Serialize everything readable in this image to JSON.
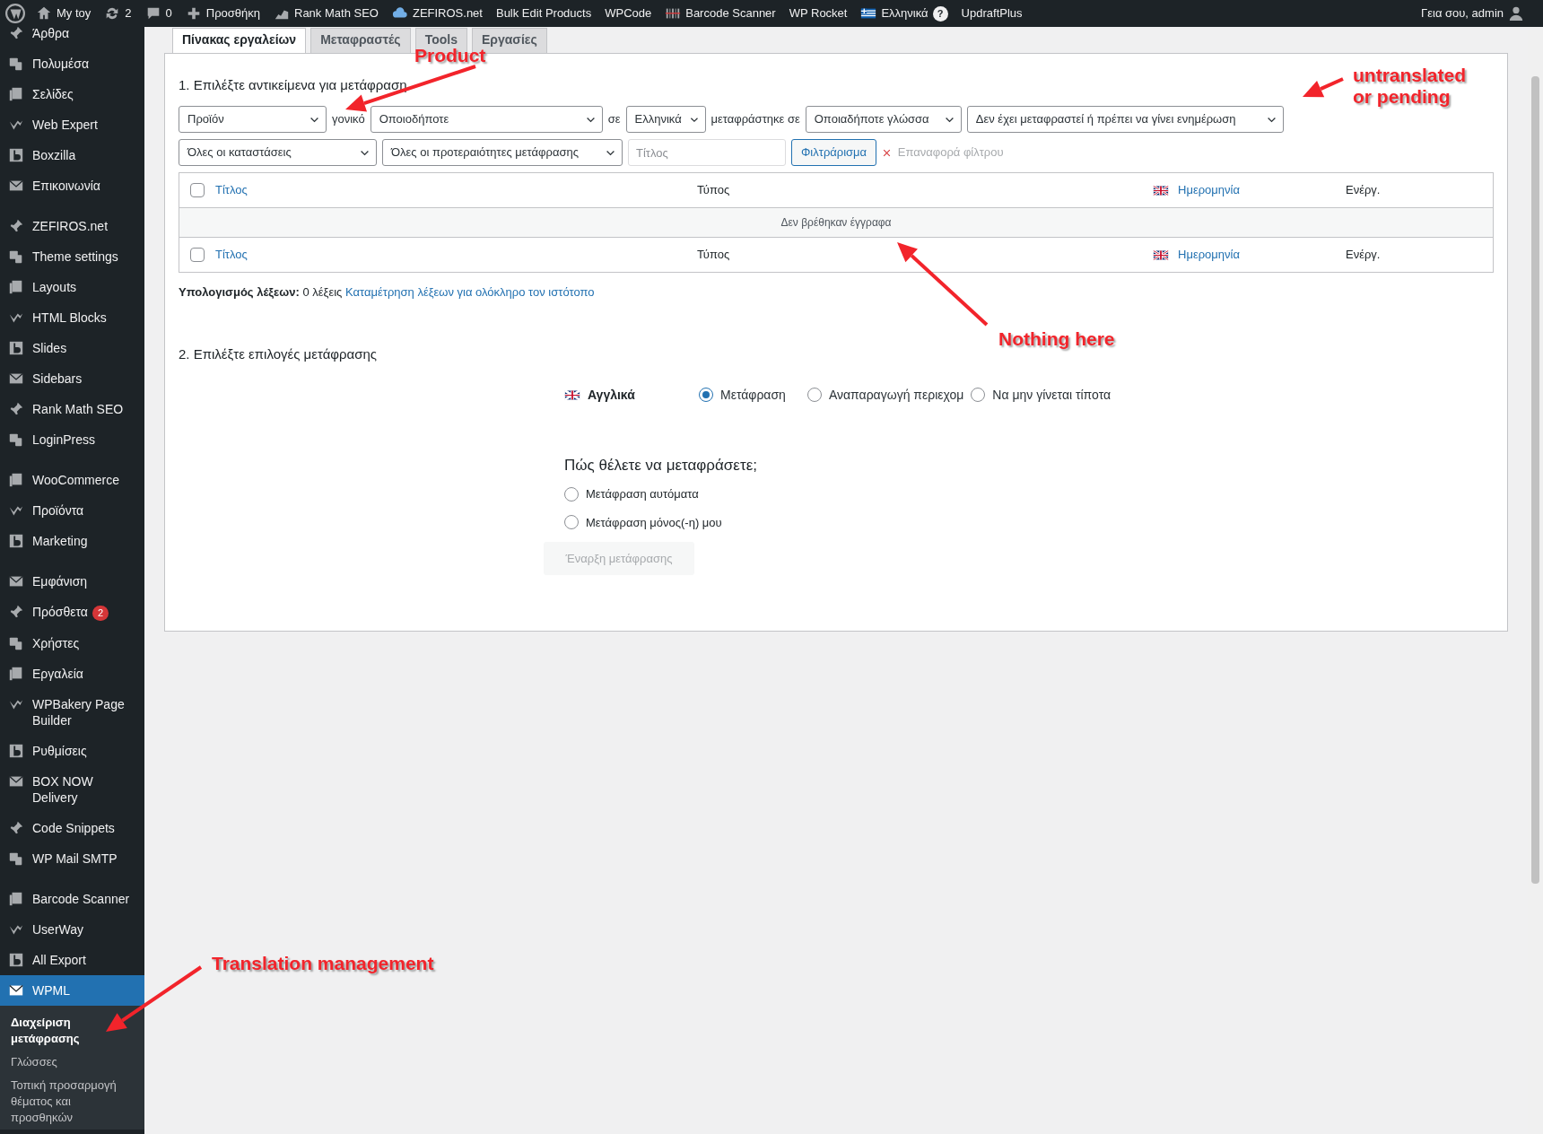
{
  "admin_bar": {
    "items": [
      {
        "label": "My toy"
      },
      {
        "label": "2"
      },
      {
        "label": "0"
      },
      {
        "label": "Προσθήκη"
      },
      {
        "label": "Rank Math SEO"
      },
      {
        "label": "ZEFIROS.net"
      },
      {
        "label": "Bulk Edit Products"
      },
      {
        "label": "WPCode"
      },
      {
        "label": "Barcode Scanner"
      },
      {
        "label": "WP Rocket"
      },
      {
        "label": "Ελληνικά",
        "badge": "?"
      },
      {
        "label": "UpdraftPlus"
      }
    ],
    "greeting": "Γεια σου, admin"
  },
  "sidebar": {
    "groups": [
      [
        {
          "label": "Άρθρα",
          "selected": false
        },
        {
          "label": "Πολυμέσα",
          "selected": false
        },
        {
          "label": "Σελίδες",
          "selected": false
        },
        {
          "label": "Web Expert",
          "selected": false
        },
        {
          "label": "Boxzilla",
          "selected": false
        },
        {
          "label": "Επικοινωνία",
          "selected": false
        }
      ],
      [
        {
          "label": "ZEFIROS.net",
          "selected": false
        },
        {
          "label": "Theme settings",
          "selected": false
        },
        {
          "label": "Layouts",
          "selected": false
        },
        {
          "label": "HTML Blocks",
          "selected": false
        },
        {
          "label": "Slides",
          "selected": false
        },
        {
          "label": "Sidebars",
          "selected": false
        },
        {
          "label": "Rank Math SEO",
          "selected": false
        },
        {
          "label": "LoginPress",
          "selected": false
        }
      ],
      [
        {
          "label": "WooCommerce",
          "selected": false
        },
        {
          "label": "Προϊόντα",
          "selected": false
        },
        {
          "label": "Marketing",
          "selected": false
        }
      ],
      [
        {
          "label": "Εμφάνιση",
          "selected": false
        },
        {
          "label": "Πρόσθετα",
          "selected": false,
          "badge": "2"
        },
        {
          "label": "Χρήστες",
          "selected": false
        },
        {
          "label": "Εργαλεία",
          "selected": false
        },
        {
          "label": "WPBakery Page Builder",
          "selected": false
        },
        {
          "label": "Ρυθμίσεις",
          "selected": false
        },
        {
          "label": "BOX NOW Delivery",
          "selected": false
        },
        {
          "label": "Code Snippets",
          "selected": false
        },
        {
          "label": "WP Mail SMTP",
          "selected": false
        }
      ],
      [
        {
          "label": "Barcode Scanner",
          "selected": false
        },
        {
          "label": "UserWay",
          "selected": false
        },
        {
          "label": "All Export",
          "selected": false
        },
        {
          "label": "WPML",
          "selected": true
        }
      ]
    ],
    "submenu": [
      {
        "label": "Διαχείριση μετάφρασης",
        "selected": true
      },
      {
        "label": "Γλώσσες",
        "selected": false
      },
      {
        "label": "Τοπική προσαρμογή θέματος και προσθηκών",
        "selected": false
      }
    ]
  },
  "tabs": [
    {
      "label": "Πίνακας εργαλείων",
      "selected": true
    },
    {
      "label": "Μεταφραστές",
      "selected": false
    },
    {
      "label": "Tools",
      "selected": false
    },
    {
      "label": "Εργασίες",
      "selected": false
    }
  ],
  "section1": {
    "title": "1. Επιλέξτε αντικείμενα για μετάφραση",
    "filter_rows": [
      [
        {
          "kind": "select",
          "value": "Προϊόν"
        },
        {
          "kind": "label",
          "text": "γονικό"
        },
        {
          "kind": "select",
          "value": "Οποιοδήποτε"
        },
        {
          "kind": "label",
          "text": "σε"
        },
        {
          "kind": "select",
          "value": "Ελληνικά"
        },
        {
          "kind": "label",
          "text": "μεταφράστηκε σε"
        },
        {
          "kind": "select",
          "value": "Οποιαδήποτε γλώσσα"
        },
        {
          "kind": "select",
          "value": "Δεν έχει μεταφραστεί ή πρέπει να γίνει ενημέρωση"
        }
      ],
      [
        {
          "kind": "select",
          "value": "Όλες οι καταστάσεις"
        },
        {
          "kind": "select",
          "value": "Όλες οι προτεραιότητες μετάφρασης"
        },
        {
          "kind": "input",
          "placeholder": "Τίτλος"
        },
        {
          "kind": "button",
          "text": "Φιλτράρισμα"
        },
        {
          "kind": "reset",
          "text": "Επαναφορά φίλτρου"
        }
      ]
    ],
    "table": {
      "header": [
        {
          "label": "Τίτλος",
          "kind": "sortable"
        },
        {
          "label": "Τύπος",
          "kind": "plain"
        },
        {
          "label": "Ημερομηνία",
          "kind": "sortable-flag"
        },
        {
          "label": "Ενέργ.",
          "kind": "plain"
        }
      ],
      "header_checked": false,
      "empty_message": "Δεν βρέθηκαν έγγραφα",
      "footer": [
        {
          "label": "Τίτλος",
          "kind": "sortable"
        },
        {
          "label": "Τύπος",
          "kind": "plain"
        },
        {
          "label": "Ημερομηνία",
          "kind": "sortable-flag"
        },
        {
          "label": "Ενέργ.",
          "kind": "plain"
        }
      ],
      "footer_checked": false
    },
    "word_count": {
      "label": "Υπολογισμός λέξεων:",
      "value": "0 λέξεις",
      "link": "Καταμέτρηση λέξεων για ολόκληρο τον ιστότοπο"
    }
  },
  "section2": {
    "title": "2. Επιλέξτε επιλογές μετάφρασης",
    "language": "Αγγλικά",
    "options": [
      {
        "label": "Μετάφραση",
        "selected": true
      },
      {
        "label": "Αναπαραγωγή περιεχομ",
        "selected": false
      },
      {
        "label": "Να μην γίνεται τίποτα",
        "selected": false
      }
    ],
    "question": "Πώς θέλετε να μεταφράσετε;",
    "methods": [
      {
        "label": "Μετάφραση αυτόματα",
        "selected": false
      },
      {
        "label": "Μετάφραση μόνος(-η) μου",
        "selected": false
      }
    ],
    "button": {
      "label": "Έναρξη μετάφρασης",
      "disabled": true
    }
  },
  "annotations": [
    {
      "text": "Product"
    },
    {
      "text": "untranslated or pending"
    },
    {
      "text": "Nothing here"
    },
    {
      "text": "Translation management"
    }
  ]
}
